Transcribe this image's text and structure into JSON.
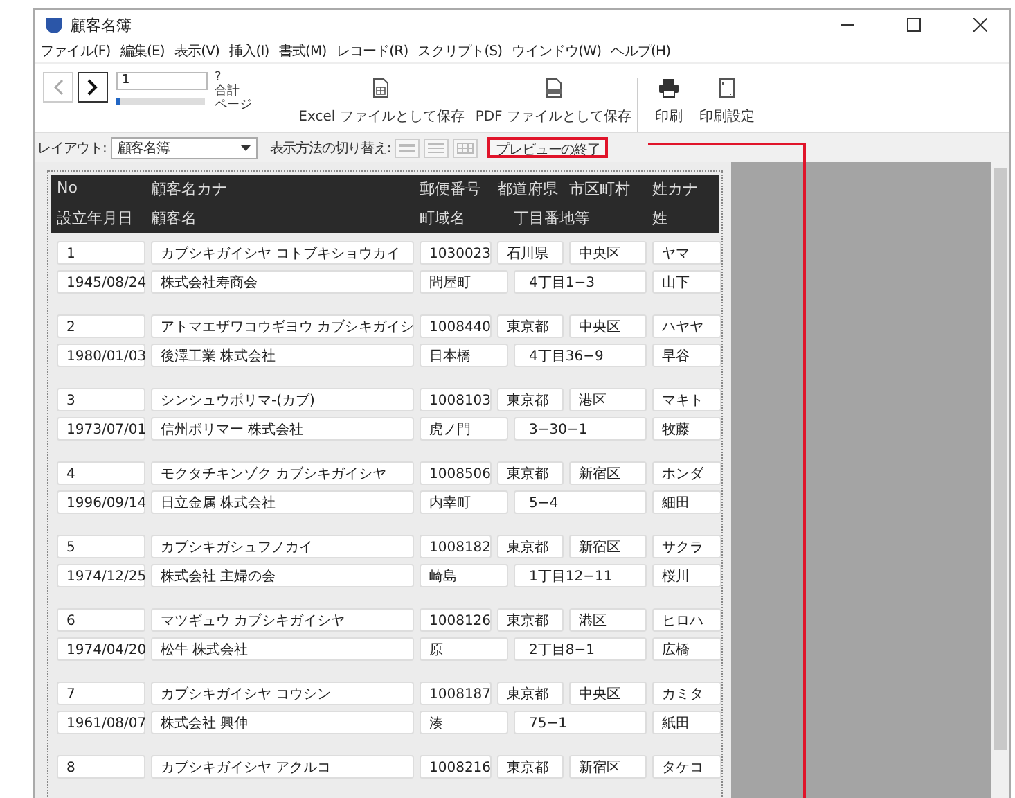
{
  "window": {
    "title": "顧客名簿"
  },
  "menu": [
    "ファイル(F)",
    "編集(E)",
    "表示(V)",
    "挿入(I)",
    "書式(M)",
    "レコード(R)",
    "スクリプト(S)",
    "ウインドウ(W)",
    "ヘルプ(H)"
  ],
  "toolbar": {
    "page_field": {
      "value": "1"
    },
    "page_slider": {
      "level": 0.03
    },
    "page_total": "?",
    "total_label": "合計",
    "page_label": "ページ",
    "actions": [
      {
        "label": "Excel ファイルとして保存",
        "kind": "excel"
      },
      {
        "label": "PDF ファイルとして保存",
        "kind": "pdf"
      },
      {
        "label": "印刷",
        "kind": "print"
      },
      {
        "label": "印刷設定",
        "kind": "page-setup"
      }
    ]
  },
  "layout_bar": {
    "label": "レイアウト:",
    "layout": "顧客名簿",
    "view_label": "表示方法の切り替え:",
    "view_buttons": [
      {
        "kind": "form"
      },
      {
        "kind": "list"
      },
      {
        "kind": "table"
      }
    ],
    "exit_button": {
      "label": "プレビューの終了",
      "annotated": true
    }
  },
  "header": {
    "line1": [
      "No",
      "顧客名カナ",
      "郵便番号",
      "都道府県",
      "市区町村",
      "姓カナ"
    ],
    "line2": [
      "設立年月日",
      "顧客名",
      "町域名",
      "丁目番地等",
      "姓"
    ]
  },
  "records": [
    {
      "line1": [
        "1",
        "カブシキガイシヤ コトブキショウカイ",
        "1030023",
        "石川県",
        "中央区",
        "ヤマ"
      ],
      "line2": [
        "1945/08/24",
        "株式会社寿商会",
        "問屋町",
        "4丁目1−3",
        "山下"
      ]
    },
    {
      "line1": [
        "2",
        "アトマエザワコウギヨウ カブシキガイシ",
        "1008440",
        "東京都",
        "中央区",
        "ハヤヤ"
      ],
      "line2": [
        "1980/01/03",
        "後澤工業 株式会社",
        "日本橋",
        "4丁目36−9",
        "早谷"
      ]
    },
    {
      "line1": [
        "3",
        "シンシュウポリマ-(カブ)",
        "1008103",
        "東京都",
        "港区",
        "マキト"
      ],
      "line2": [
        "1973/07/01",
        "信州ポリマー 株式会社",
        "虎ノ門",
        "3−30−1",
        "牧藤"
      ]
    },
    {
      "line1": [
        "4",
        "モクタチキンゾク カブシキガイシヤ",
        "1008506",
        "東京都",
        "新宿区",
        "ホンダ"
      ],
      "line2": [
        "1996/09/14",
        "日立金属 株式会社",
        "内幸町",
        "5−4",
        "細田"
      ]
    },
    {
      "line1": [
        "5",
        "カブシキガシュフノカイ",
        "1008182",
        "東京都",
        "新宿区",
        "サクラ"
      ],
      "line2": [
        "1974/12/25",
        "株式会社 主婦の会",
        "崎島",
        "1丁目12−11",
        "桜川"
      ]
    },
    {
      "line1": [
        "6",
        "マツギュウ カブシキガイシヤ",
        "1008126",
        "東京都",
        "港区",
        "ヒロハ"
      ],
      "line2": [
        "1974/04/20",
        "松牛 株式会社",
        "原",
        "2丁目8−1",
        "広橋"
      ]
    },
    {
      "line1": [
        "7",
        "カブシキガイシヤ コウシン",
        "1008187",
        "東京都",
        "中央区",
        "カミタ"
      ],
      "line2": [
        "1961/08/07",
        "株式会社 興伸",
        "湊",
        "75−1",
        "紙田"
      ]
    },
    {
      "line1": [
        "8",
        "カブシキガイシヤ アクルコ",
        "1008216",
        "東京都",
        "新宿区",
        "タケコ"
      ]
    }
  ]
}
